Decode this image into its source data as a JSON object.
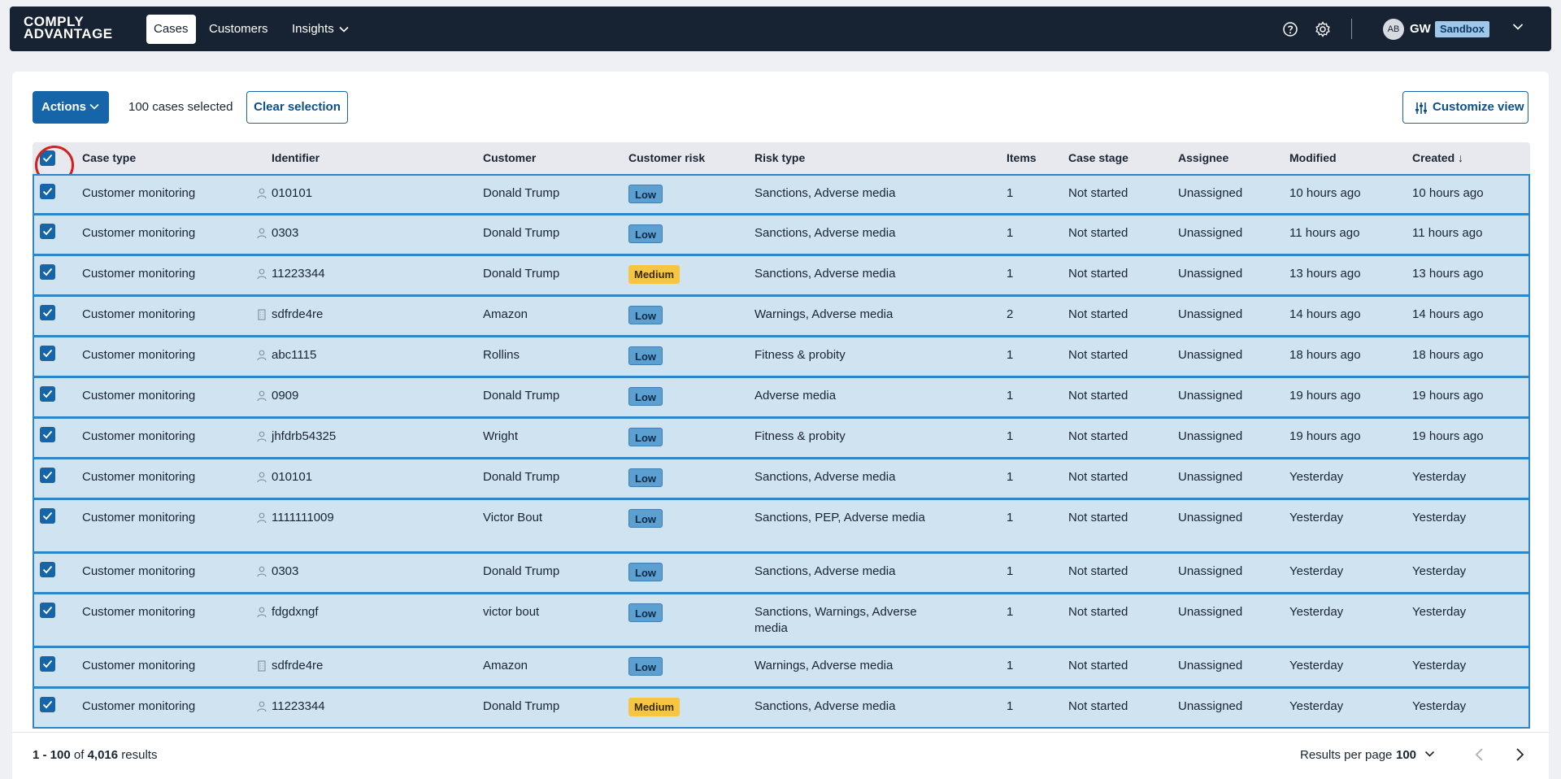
{
  "header": {
    "logo_line1": "COMPLY",
    "logo_line2": "ADVANTAGE",
    "nav": [
      {
        "label": "Cases",
        "active": true
      },
      {
        "label": "Customers",
        "active": false
      },
      {
        "label": "Insights",
        "active": false
      }
    ],
    "avatar_initials": "AB",
    "user_initials": "GW",
    "environment": "Sandbox",
    "icons": [
      "help-icon",
      "settings-icon",
      "chevron-down-icon"
    ]
  },
  "toolbar": {
    "actions_label": "Actions",
    "selected_text": "100 cases selected",
    "clear_label": "Clear selection",
    "customize_label": "Customize view"
  },
  "table": {
    "select_all_checked": true,
    "sort_indicator": "↓",
    "columns": [
      "Case type",
      "Identifier",
      "Customer",
      "Customer risk",
      "Risk type",
      "Items",
      "Case stage",
      "Assignee",
      "Modified",
      "Created"
    ],
    "rows": [
      {
        "case_type": "Customer monitoring",
        "id_kind": "person",
        "identifier": "010101",
        "customer": "Donald Trump",
        "risk": "Low",
        "risk_type": "Sanctions, Adverse media",
        "items": "1",
        "stage": "Not started",
        "assignee": "Unassigned",
        "modified": "10 hours ago",
        "created": "10 hours ago"
      },
      {
        "case_type": "Customer monitoring",
        "id_kind": "person",
        "identifier": "0303",
        "customer": "Donald Trump",
        "risk": "Low",
        "risk_type": "Sanctions, Adverse media",
        "items": "1",
        "stage": "Not started",
        "assignee": "Unassigned",
        "modified": "11 hours ago",
        "created": "11 hours ago"
      },
      {
        "case_type": "Customer monitoring",
        "id_kind": "person",
        "identifier": "11223344",
        "customer": "Donald Trump",
        "risk": "Medium",
        "risk_type": "Sanctions, Adverse media",
        "items": "1",
        "stage": "Not started",
        "assignee": "Unassigned",
        "modified": "13 hours ago",
        "created": "13 hours ago"
      },
      {
        "case_type": "Customer monitoring",
        "id_kind": "company",
        "identifier": "sdfrde4re",
        "customer": "Amazon",
        "risk": "Low",
        "risk_type": "Warnings, Adverse media",
        "items": "2",
        "stage": "Not started",
        "assignee": "Unassigned",
        "modified": "14 hours ago",
        "created": "14 hours ago"
      },
      {
        "case_type": "Customer monitoring",
        "id_kind": "person",
        "identifier": "abc1115",
        "customer": "Rollins",
        "risk": "Low",
        "risk_type": "Fitness & probity",
        "items": "1",
        "stage": "Not started",
        "assignee": "Unassigned",
        "modified": "18 hours ago",
        "created": "18 hours ago"
      },
      {
        "case_type": "Customer monitoring",
        "id_kind": "person",
        "identifier": "0909",
        "customer": "Donald Trump",
        "risk": "Low",
        "risk_type": "Adverse media",
        "items": "1",
        "stage": "Not started",
        "assignee": "Unassigned",
        "modified": "19 hours ago",
        "created": "19 hours ago"
      },
      {
        "case_type": "Customer monitoring",
        "id_kind": "person",
        "identifier": "jhfdrb54325",
        "customer": "Wright",
        "risk": "Low",
        "risk_type": "Fitness & probity",
        "items": "1",
        "stage": "Not started",
        "assignee": "Unassigned",
        "modified": "19 hours ago",
        "created": "19 hours ago"
      },
      {
        "case_type": "Customer monitoring",
        "id_kind": "person",
        "identifier": "010101",
        "customer": "Donald Trump",
        "risk": "Low",
        "risk_type": "Sanctions, Adverse media",
        "items": "1",
        "stage": "Not started",
        "assignee": "Unassigned",
        "modified": "Yesterday",
        "created": "Yesterday"
      },
      {
        "case_type": "Customer monitoring",
        "id_kind": "person",
        "identifier": "1111111009",
        "customer": "Victor Bout",
        "risk": "Low",
        "risk_type": "Sanctions, PEP, Adverse media",
        "items": "1",
        "stage": "Not started",
        "assignee": "Unassigned",
        "modified": "Yesterday",
        "created": "Yesterday"
      },
      {
        "case_type": "Customer monitoring",
        "id_kind": "person",
        "identifier": "0303",
        "customer": "Donald Trump",
        "risk": "Low",
        "risk_type": "Sanctions, Adverse media",
        "items": "1",
        "stage": "Not started",
        "assignee": "Unassigned",
        "modified": "Yesterday",
        "created": "Yesterday"
      },
      {
        "case_type": "Customer monitoring",
        "id_kind": "person",
        "identifier": "fdgdxngf",
        "customer": "victor bout",
        "risk": "Low",
        "risk_type": "Sanctions, Warnings, Adverse media",
        "items": "1",
        "stage": "Not started",
        "assignee": "Unassigned",
        "modified": "Yesterday",
        "created": "Yesterday"
      },
      {
        "case_type": "Customer monitoring",
        "id_kind": "company",
        "identifier": "sdfrde4re",
        "customer": "Amazon",
        "risk": "Low",
        "risk_type": "Warnings, Adverse media",
        "items": "1",
        "stage": "Not started",
        "assignee": "Unassigned",
        "modified": "Yesterday",
        "created": "Yesterday"
      },
      {
        "case_type": "Customer monitoring",
        "id_kind": "person",
        "identifier": "11223344",
        "customer": "Donald Trump",
        "risk": "Medium",
        "risk_type": "Sanctions, Adverse media",
        "items": "1",
        "stage": "Not started",
        "assignee": "Unassigned",
        "modified": "Yesterday",
        "created": "Yesterday"
      }
    ]
  },
  "footer": {
    "range_start_end": "1 - 100",
    "of_word": "of",
    "total": "4,016",
    "results_word": "results",
    "results_per_page_label": "Results per page",
    "results_per_page": "100"
  },
  "colors": {
    "topbar": "#172233",
    "primary": "#1565a8",
    "row_selected": "#cfe3f1",
    "row_border": "#2f86c6",
    "risk_low": "#5c9fd1",
    "risk_medium": "#f6c542",
    "highlight_ring": "#d62020"
  }
}
